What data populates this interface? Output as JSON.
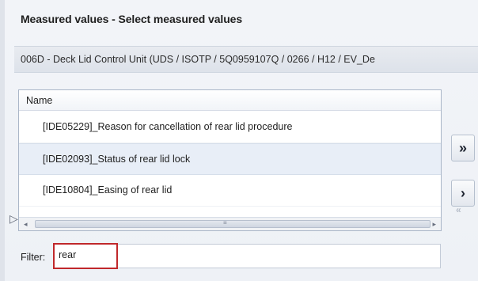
{
  "dialog": {
    "title": "Measured values - Select measured values"
  },
  "ecu": {
    "selection_text": "006D - Deck Lid Control Unit  (UDS / ISOTP / 5Q0959107Q / 0266 / H12 / EV_De"
  },
  "list": {
    "column_header": "Name",
    "selected_index": 1,
    "items": [
      {
        "label": "[IDE05229]_Reason for cancellation of rear lid procedure"
      },
      {
        "label": "[IDE02093]_Status of rear lid lock"
      },
      {
        "label": "[IDE10804]_Easing of rear lid"
      }
    ]
  },
  "buttons": {
    "add_all_symbol": "»",
    "add_symbol": "›"
  },
  "filter": {
    "label": "Filter:",
    "value": "rear"
  }
}
